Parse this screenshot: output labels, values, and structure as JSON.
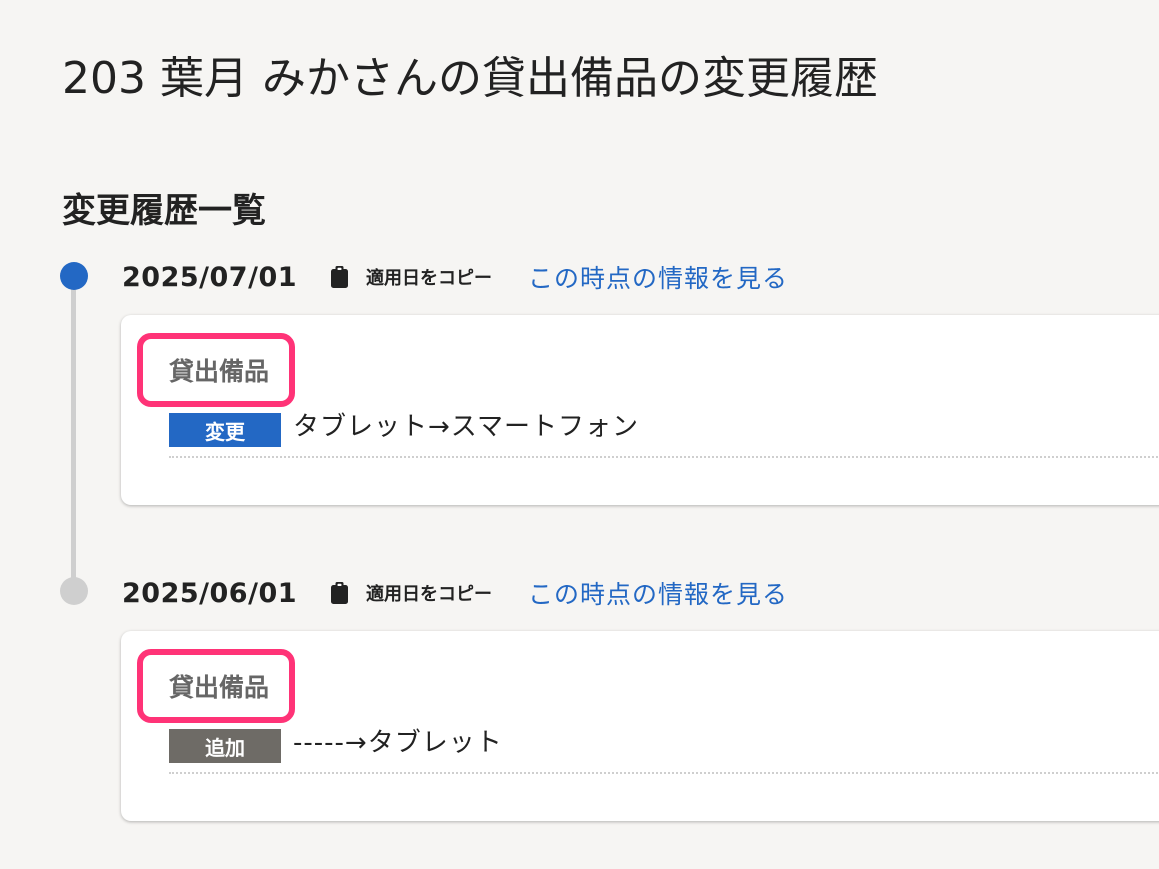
{
  "page": {
    "title": "203 葉月 みかさんの貸出備品の変更履歴",
    "section_title": "変更履歴一覧"
  },
  "colors": {
    "accent": "#2368c4",
    "highlight": "#ff3377",
    "add_badge": "#6e6b66",
    "timeline": "#cfcfcf"
  },
  "history": [
    {
      "date": "2025/07/01",
      "copy_label": "適用日をコピー",
      "copy_icon": "clipboard-icon",
      "view_link": "この時点の情報を見る",
      "item_label": "貸出備品",
      "badge": "変更",
      "change": "タブレット→スマートフォン"
    },
    {
      "date": "2025/06/01",
      "copy_label": "適用日をコピー",
      "copy_icon": "clipboard-icon",
      "view_link": "この時点の情報を見る",
      "item_label": "貸出備品",
      "badge": "追加",
      "change": "-----→タブレット"
    }
  ]
}
